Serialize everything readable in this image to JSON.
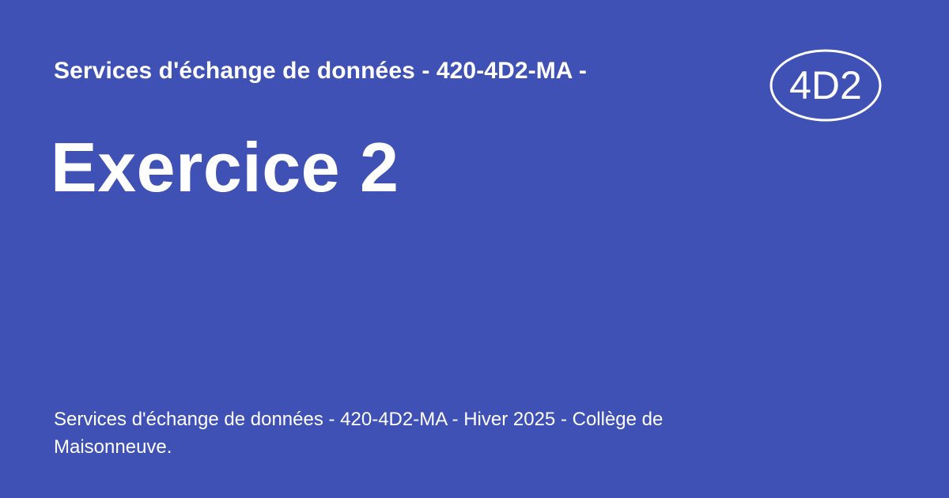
{
  "site": {
    "title": "Services d'échange de données - 420-4D2-MA -"
  },
  "page": {
    "title": "Exercice 2",
    "description": "Services d'échange de données - 420-4D2-MA - Hiver 2025 - Collège de Maisonneuve."
  },
  "logo": {
    "text": "4D2",
    "icon": "ellipse-badge-icon"
  },
  "colors": {
    "background": "#3f51b5",
    "foreground": "#ffffff"
  }
}
